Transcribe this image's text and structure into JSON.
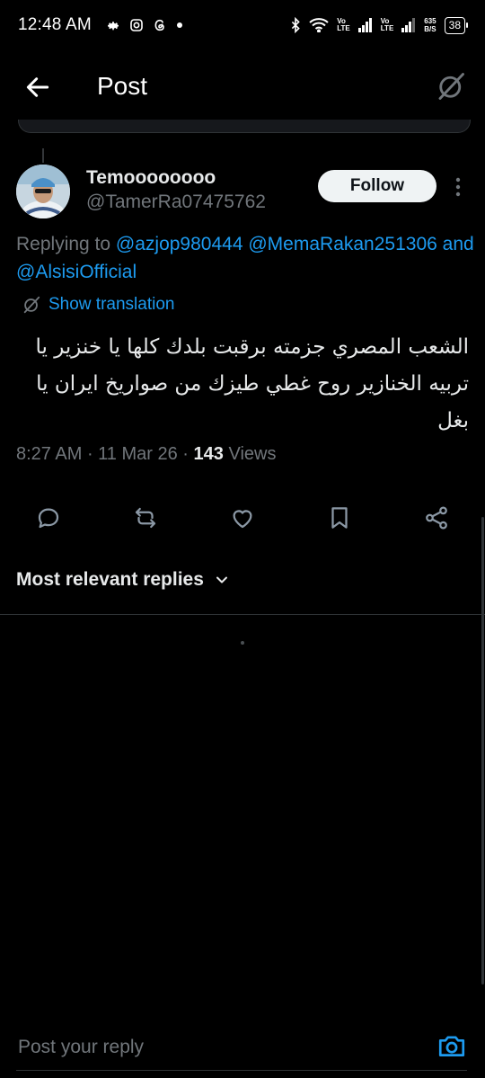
{
  "status_bar": {
    "time": "12:48 AM",
    "lte1": [
      "Vo",
      "LTE"
    ],
    "lte2": [
      "Vo",
      "LTE"
    ],
    "speed": [
      "635",
      "B/S"
    ],
    "battery": "38"
  },
  "header": {
    "title": "Post"
  },
  "post": {
    "author_name": "Temoooooooo",
    "author_handle": "@TamerRa07475762",
    "follow_label": "Follow",
    "replying_prefix": "Replying to",
    "mention_1": "@azjop980444",
    "mention_2": "@MemaRakan251306",
    "replying_and": "and",
    "mention_3": "@AlsisiOfficial",
    "translate_label": "Show translation",
    "text": "الشعب المصري جزمته برقبت بلدك كلها يا خنزير يا تربيه الخنازير روح  غطي طيزك من صواريخ ايران يا بغل",
    "time": "8:27 AM",
    "date": "11 Mar 26",
    "views_count": "143",
    "views_label": "Views"
  },
  "replies": {
    "sort_label": "Most relevant replies"
  },
  "reply_bar": {
    "placeholder": "Post your reply"
  },
  "colors": {
    "accent": "#1d9bf0",
    "background": "#000000",
    "muted": "#71767b",
    "text": "#e7e9ea"
  },
  "icons": [
    "arrow-left-icon",
    "grok-icon",
    "more-vertical-icon",
    "translate-icon",
    "reply-icon",
    "repost-icon",
    "like-icon",
    "bookmark-icon",
    "share-icon",
    "chevron-down-icon",
    "camera-icon"
  ]
}
